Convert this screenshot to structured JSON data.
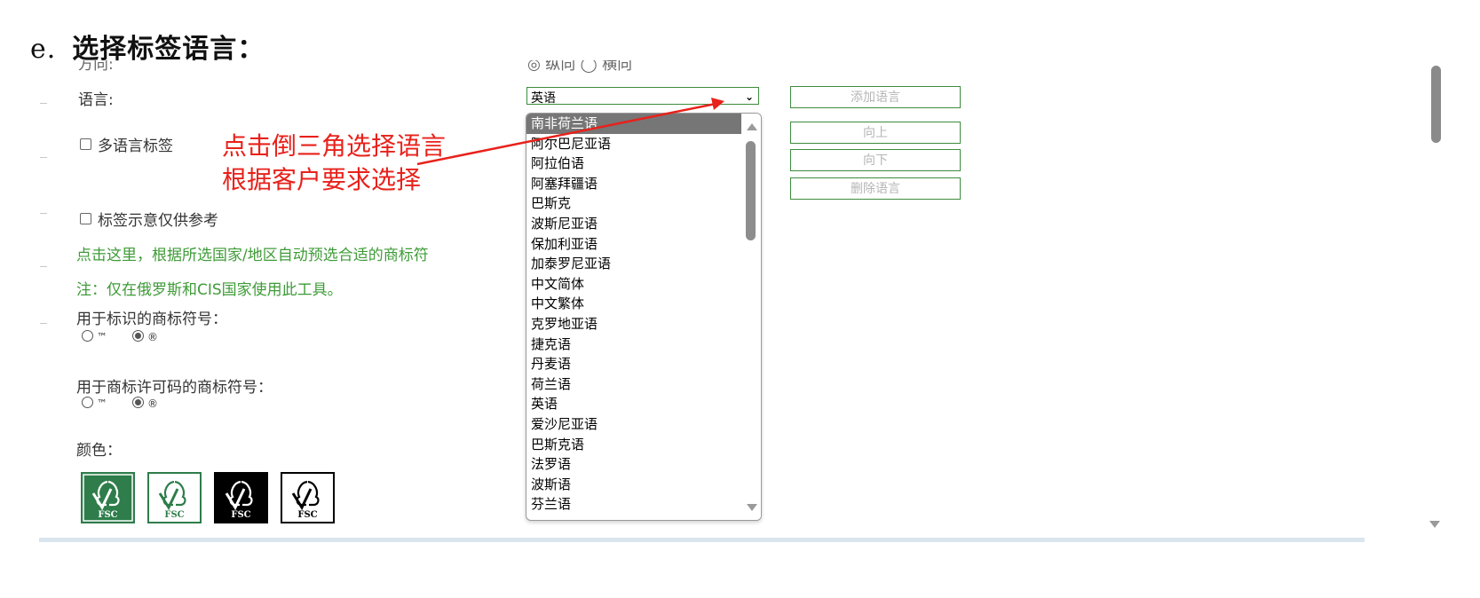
{
  "heading": {
    "number": "e.",
    "title": "选择标签语言："
  },
  "form": {
    "direction_label": "方向:",
    "direction_options": "◎ 纵向 ◯ 横向",
    "language_label": "语言:",
    "language_selected": "英语",
    "multi_language_label": "多语言标签",
    "label_preview_note": "标签示意仅供参考",
    "auto_preselect_link": "点击这里，根据所选国家/地区自动预选合适的商标符",
    "cis_note": "注：仅在俄罗斯和CIS国家使用此工具。",
    "trademark_identification_label": "用于标识的商标符号：",
    "trademark_license_label": "用于商标许可码的商标符号：",
    "tm_symbol": "™",
    "r_symbol": "®",
    "color_label": "颜色：",
    "fsc_text": "FSC"
  },
  "buttons": {
    "add_language": "添加语言",
    "move_up": "向上",
    "move_down": "向下",
    "delete_language": "删除语言"
  },
  "dropdown": {
    "items": [
      "南非荷兰语",
      "阿尔巴尼亚语",
      "阿拉伯语",
      "阿塞拜疆语",
      "巴斯克",
      "波斯尼亚语",
      "保加利亚语",
      "加泰罗尼亚语",
      "中文简体",
      "中文繁体",
      "克罗地亚语",
      "捷克语",
      "丹麦语",
      "荷兰语",
      "英语",
      "爱沙尼亚语",
      "巴斯克语",
      "法罗语",
      "波斯语",
      "芬兰语"
    ],
    "highlighted": "南非荷兰语"
  },
  "annotation": {
    "line1": "点击倒三角选择语言",
    "line2": "根据客户要求选择"
  },
  "colors": {
    "accent_green": "#3f9b38",
    "annotation_red": "#e8211b",
    "fsc_green": "#2e7d4a"
  }
}
